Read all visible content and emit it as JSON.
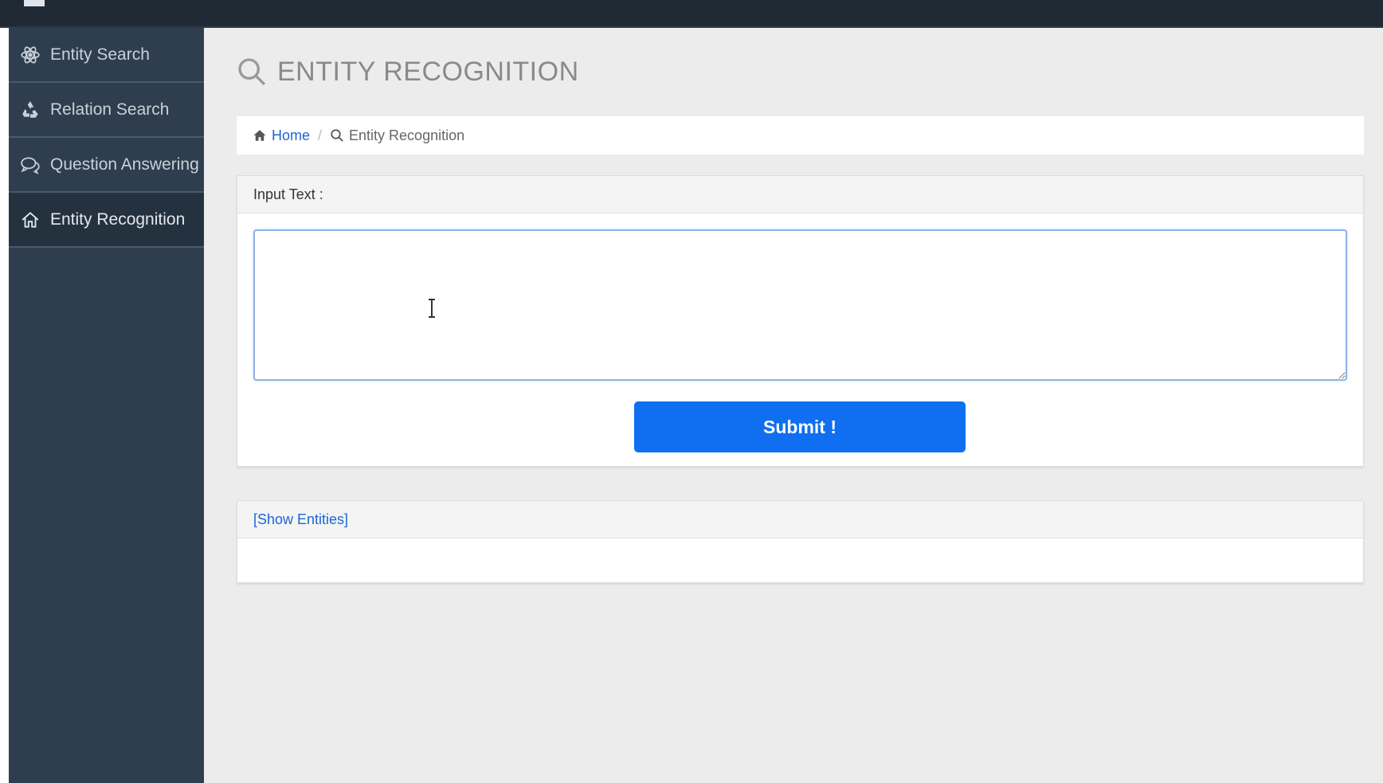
{
  "sidebar": {
    "items": [
      {
        "label": "Entity Search",
        "icon": "atom-icon",
        "active": false
      },
      {
        "label": "Relation Search",
        "icon": "recycle-icon",
        "active": false
      },
      {
        "label": "Question Answering",
        "icon": "chat-icon",
        "active": false
      },
      {
        "label": "Entity Recognition",
        "icon": "home-icon",
        "active": true
      }
    ]
  },
  "page": {
    "title": "ENTITY RECOGNITION"
  },
  "breadcrumb": {
    "home": "Home",
    "separator": "/",
    "current": "Entity Recognition"
  },
  "input_panel": {
    "heading": "Input Text :",
    "textarea_value": "",
    "submit_label": "Submit !"
  },
  "entities_panel": {
    "toggle_label": "[Show Entities]"
  },
  "colors": {
    "topbar": "#1f2a35",
    "sidebar": "#2e3e4e",
    "accent": "#0f6ff0",
    "link": "#1a66d6"
  }
}
